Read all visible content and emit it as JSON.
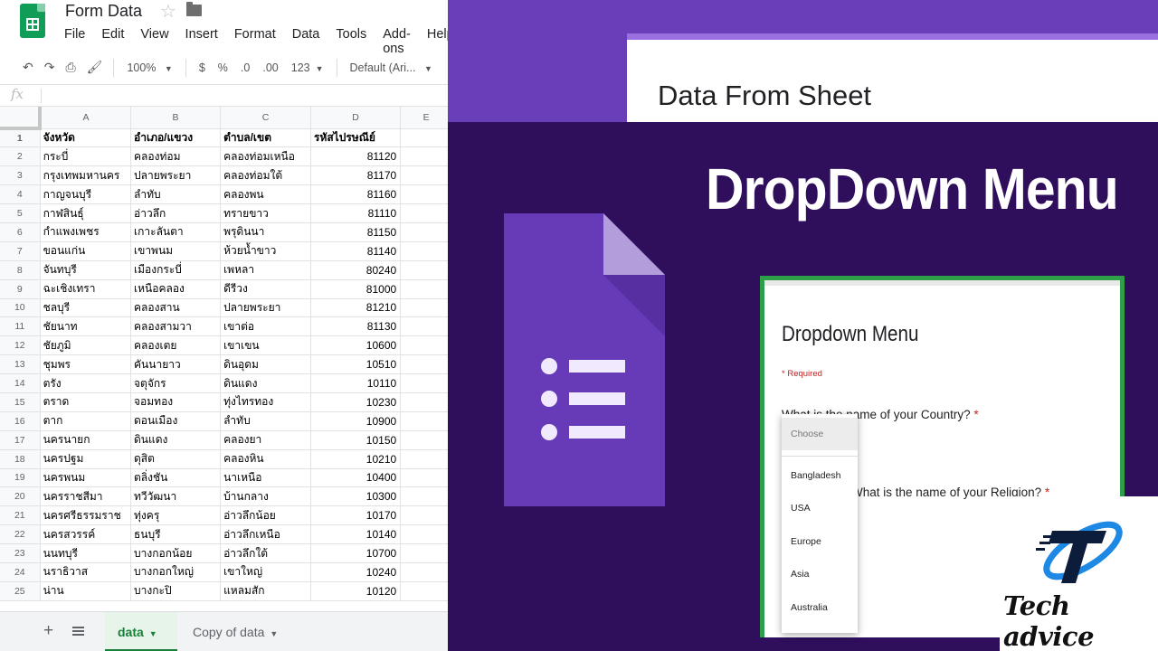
{
  "sheets": {
    "title": "Form Data",
    "menu": [
      "File",
      "Edit",
      "View",
      "Insert",
      "Format",
      "Data",
      "Tools",
      "Add-ons",
      "Help"
    ],
    "toolbar": {
      "zoom": "100%",
      "currency": "$",
      "percent": "%",
      "decrease_decimals": ".0",
      "increase_decimals": ".00",
      "more_formats": "123",
      "font": "Default (Ari..."
    },
    "formula_label": "fx",
    "columns": [
      "A",
      "B",
      "C",
      "D",
      "E"
    ],
    "rows": [
      {
        "n": "1",
        "a": "จังหวัด",
        "b": "อำเภอ/แขวง",
        "c": "ตำบล/เขต",
        "d": "รหัสไปรษณีย์"
      },
      {
        "n": "2",
        "a": "กระบี่",
        "b": "คลองท่อม",
        "c": "คลองท่อมเหนือ",
        "d": "81120"
      },
      {
        "n": "3",
        "a": "กรุงเทพมหานคร",
        "b": "ปลายพระยา",
        "c": "คลองท่อมใต้",
        "d": "81170"
      },
      {
        "n": "4",
        "a": "กาญจนบุรี",
        "b": "ลำทับ",
        "c": "คลองพน",
        "d": "81160"
      },
      {
        "n": "5",
        "a": "กาฬสินธุ์",
        "b": "อ่าวลึก",
        "c": "ทรายขาว",
        "d": "81110"
      },
      {
        "n": "6",
        "a": "กำแพงเพชร",
        "b": "เกาะลันตา",
        "c": "พรุดินนา",
        "d": "81150"
      },
      {
        "n": "7",
        "a": "ขอนแก่น",
        "b": "เขาพนม",
        "c": "ห้วยน้ำขาว",
        "d": "81140"
      },
      {
        "n": "8",
        "a": "จันทบุรี",
        "b": "เมืองกระบี่",
        "c": "เพหลา",
        "d": "80240"
      },
      {
        "n": "9",
        "a": "ฉะเชิงเทรา",
        "b": "เหนือคลอง",
        "c": "ดีรีวง",
        "d": "81000"
      },
      {
        "n": "10",
        "a": "ชลบุรี",
        "b": "คลองสาน",
        "c": "ปลายพระยา",
        "d": "81210"
      },
      {
        "n": "11",
        "a": "ชัยนาท",
        "b": "คลองสามวา",
        "c": "เขาต่อ",
        "d": "81130"
      },
      {
        "n": "12",
        "a": "ชัยภูมิ",
        "b": "คลองเตย",
        "c": "เขาเขน",
        "d": "10600"
      },
      {
        "n": "13",
        "a": "ชุมพร",
        "b": "คันนายาว",
        "c": "ดินอุดม",
        "d": "10510"
      },
      {
        "n": "14",
        "a": "ตรัง",
        "b": "จตุจักร",
        "c": "ดินแดง",
        "d": "10110"
      },
      {
        "n": "15",
        "a": "ตราด",
        "b": "จอมทอง",
        "c": "ทุ่งไทรทอง",
        "d": "10230"
      },
      {
        "n": "16",
        "a": "ตาก",
        "b": "ดอนเมือง",
        "c": "ลำทับ",
        "d": "10900"
      },
      {
        "n": "17",
        "a": "นครนายก",
        "b": "ดินแดง",
        "c": "คลองยา",
        "d": "10150"
      },
      {
        "n": "18",
        "a": "นครปฐม",
        "b": "ดุสิต",
        "c": "คลองหิน",
        "d": "10210"
      },
      {
        "n": "19",
        "a": "นครพนม",
        "b": "ตลิ่งชัน",
        "c": "นาเหนือ",
        "d": "10400"
      },
      {
        "n": "20",
        "a": "นครราชสีมา",
        "b": "ทวีวัฒนา",
        "c": "บ้านกลาง",
        "d": "10300"
      },
      {
        "n": "21",
        "a": "นครศรีธรรมราช",
        "b": "ทุ่งครุ",
        "c": "อ่าวลึกน้อย",
        "d": "10170"
      },
      {
        "n": "22",
        "a": "นครสวรรค์",
        "b": "ธนบุรี",
        "c": "อ่าวลึกเหนือ",
        "d": "10140"
      },
      {
        "n": "23",
        "a": "นนทบุรี",
        "b": "บางกอกน้อย",
        "c": "อ่าวลึกใต้",
        "d": "10700"
      },
      {
        "n": "24",
        "a": "นราธิวาส",
        "b": "บางกอกใหญ่",
        "c": "เขาใหญ่",
        "d": "10240"
      },
      {
        "n": "25",
        "a": "น่าน",
        "b": "บางกะปิ",
        "c": "แหลมสัก",
        "d": "10120"
      }
    ],
    "tabs": {
      "active": "data",
      "other": "Copy of data"
    }
  },
  "promo": {
    "top_card_title": "Data From Sheet",
    "headline": "DropDown Menu",
    "form": {
      "title": "Dropdown Menu",
      "required_note": "* Required",
      "q1": "What is the name of your Country?",
      "q2": "What is the name of your Religion?",
      "asterisk": "*"
    },
    "dropdown": {
      "placeholder": "Choose",
      "options": [
        "Bangladesh",
        "USA",
        "Europe",
        "Asia",
        "Australia"
      ]
    },
    "brand": "Tech advice",
    "colors": {
      "purple_band": "#6a3eb8",
      "dark_purple": "#2f0f5c",
      "forms_purple": "#673ab7",
      "sheets_green": "#0f9d58",
      "form_border_green": "#2f9e49"
    }
  }
}
